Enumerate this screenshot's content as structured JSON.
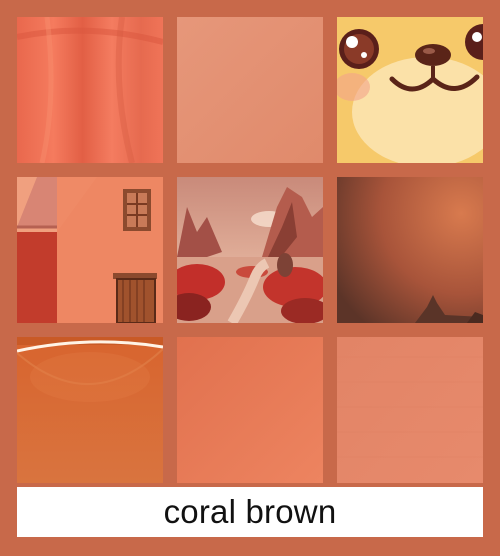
{
  "palette": {
    "background": "#c8694a",
    "swatch_main": "#ec7f5f",
    "swatch_light": "#e49070"
  },
  "tiles": [
    {
      "subject": "fabric-drape"
    },
    {
      "subject": "plain-swatch"
    },
    {
      "subject": "cartoon-dog-face"
    },
    {
      "subject": "adobe-house"
    },
    {
      "subject": "red-canyon-landscape"
    },
    {
      "subject": "dusky-gradient-rock"
    },
    {
      "subject": "glossy-bowl"
    },
    {
      "subject": "flat-swatch"
    },
    {
      "subject": "brushed-texture"
    }
  ],
  "caption": {
    "text": "coral brown"
  }
}
